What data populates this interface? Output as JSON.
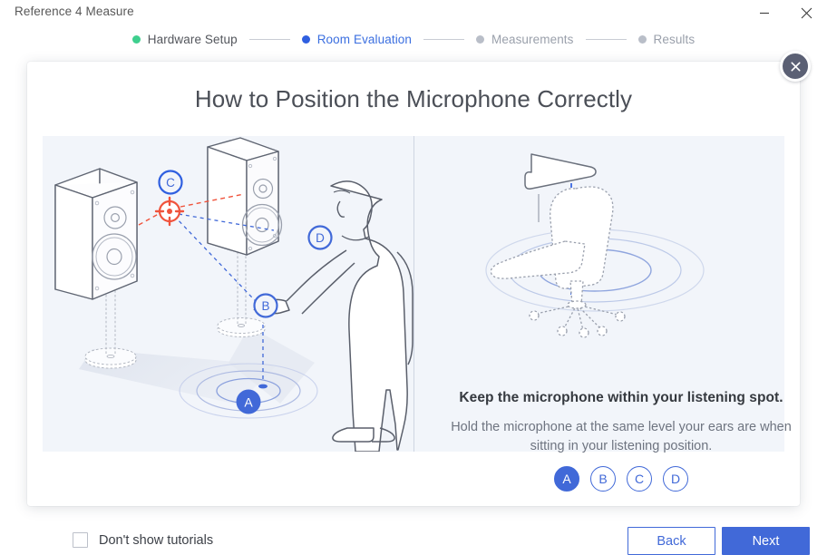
{
  "window": {
    "title": "Reference 4 Measure",
    "minimize_icon": "minimize-icon",
    "close_icon": "close-icon"
  },
  "stepper": {
    "steps": [
      {
        "label": "Hardware Setup",
        "state": "done",
        "dot_color": "#3ecf8e"
      },
      {
        "label": "Room Evaluation",
        "state": "current",
        "dot_color": "#2f5fe0"
      },
      {
        "label": "Measurements",
        "state": "todo",
        "dot_color": "#b9bec8"
      },
      {
        "label": "Results",
        "state": "todo",
        "dot_color": "#b9bec8"
      }
    ]
  },
  "dialog": {
    "title": "How to Position the Microphone Correctly",
    "close_icon": "close-circle-icon",
    "illustration": {
      "left_scene_name": "room-speakers-listener-diagram",
      "right_scene_name": "microphone-over-chair-diagram",
      "markers": [
        "A",
        "B",
        "C",
        "D"
      ]
    },
    "panel": {
      "headline": "Keep the microphone within your listening spot.",
      "body": "Hold the microphone at the same level your ears are when sitting in your listening position.",
      "pager": [
        {
          "label": "A",
          "active": true
        },
        {
          "label": "B",
          "active": false
        },
        {
          "label": "C",
          "active": false
        },
        {
          "label": "D",
          "active": false
        }
      ]
    }
  },
  "footer": {
    "checkbox_label": "Don't show tutorials",
    "checkbox_checked": false,
    "back_label": "Back",
    "next_label": "Next"
  },
  "colors": {
    "accent": "#4169d8",
    "done": "#3ecf8e",
    "muted": "#b9bec8",
    "panel_bg": "#f2f5fa",
    "target_red": "#f0533c"
  }
}
